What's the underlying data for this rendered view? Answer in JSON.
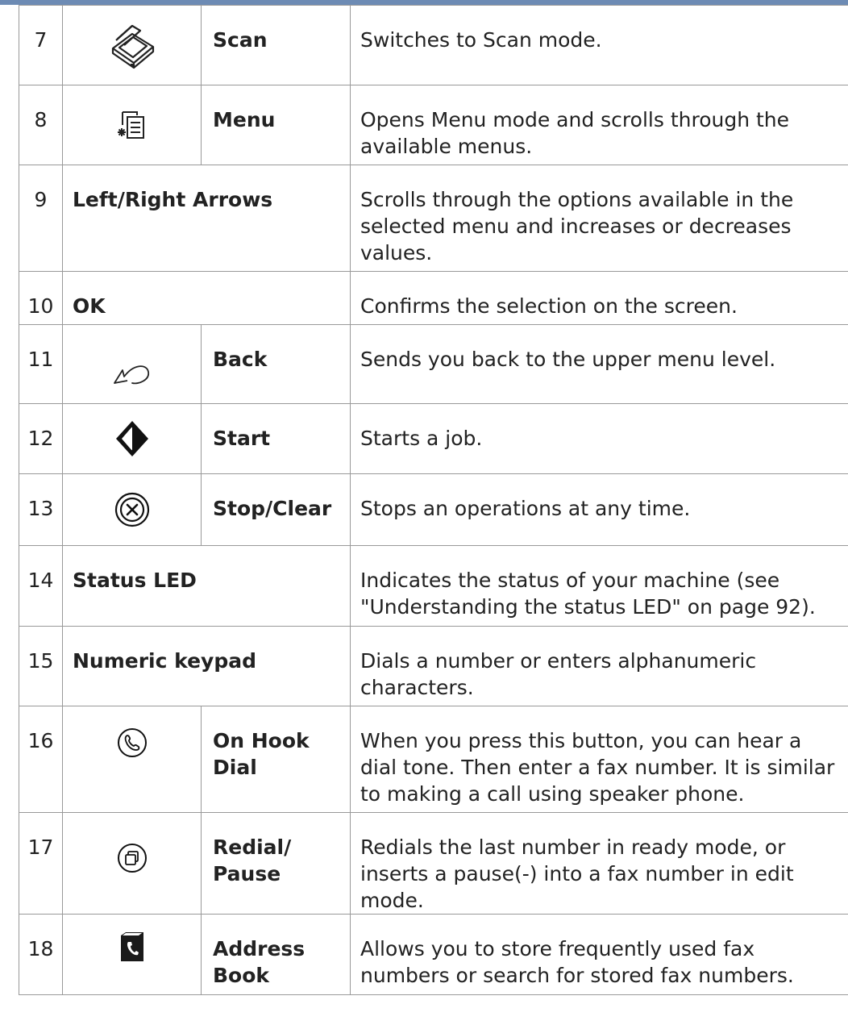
{
  "rows": [
    {
      "num": "7",
      "icon": "scanner-icon",
      "name": "Scan",
      "desc": "Switches to Scan mode."
    },
    {
      "num": "8",
      "icon": "menu-icon",
      "name": "Menu",
      "desc": "Opens Menu mode and scrolls through the available menus."
    },
    {
      "num": "9",
      "icon": "",
      "name": "Left/Right Arrows",
      "desc": "Scrolls through the options available in the selected menu and increases or decreases values."
    },
    {
      "num": "10",
      "icon": "",
      "name": "OK",
      "desc": "Confirms the selection on the screen."
    },
    {
      "num": "11",
      "icon": "back-arrow-icon",
      "name": "Back",
      "desc": "Sends you back to the upper menu level."
    },
    {
      "num": "12",
      "icon": "start-icon",
      "name": "Start",
      "desc": "Starts a job."
    },
    {
      "num": "13",
      "icon": "stop-clear-icon",
      "name": "Stop/Clear",
      "desc": "Stops an operations at any time."
    },
    {
      "num": "14",
      "icon": "",
      "name": "Status LED",
      "desc": "Indicates the status of your machine (see \"Understanding the status LED\" on page 92)."
    },
    {
      "num": "15",
      "icon": "",
      "name": "Numeric keypad",
      "desc": "Dials a number or enters alphanumeric characters."
    },
    {
      "num": "16",
      "icon": "on-hook-dial-icon",
      "name": "On Hook Dial",
      "desc": "When you press this button, you can hear a dial tone. Then enter a fax number. It is similar to making a call using speaker phone."
    },
    {
      "num": "17",
      "icon": "redial-pause-icon",
      "name": "Redial/ Pause",
      "desc": "Redials the last number in ready mode, or inserts a pause(-) into a fax number in edit mode."
    },
    {
      "num": "18",
      "icon": "address-book-icon",
      "name": "Address Book",
      "desc": "Allows you to store frequently used fax numbers or search for stored fax numbers."
    }
  ],
  "colors": {
    "header_bar": "#6d8bb4",
    "border": "#999999",
    "text": "#222222"
  }
}
